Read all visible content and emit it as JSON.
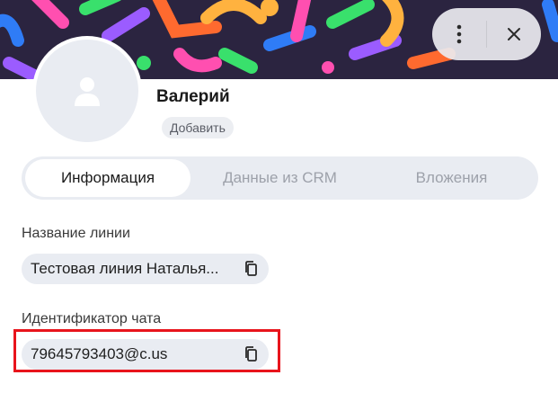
{
  "header": {
    "menu_icon": "more-vertical-icon",
    "close_icon": "close-icon",
    "banner_colors": [
      "#2b2440",
      "#2f7cf6",
      "#39e06c",
      "#ff4fb0",
      "#ffb23f",
      "#9b5cff",
      "#ff6a2f"
    ]
  },
  "contact": {
    "avatar_icon": "user-icon",
    "name": "Валерий",
    "add_label": "Добавить"
  },
  "tabs": [
    {
      "label": "Информация",
      "active": true
    },
    {
      "label": "Данные из CRM",
      "active": false
    },
    {
      "label": "Вложения",
      "active": false
    }
  ],
  "fields": [
    {
      "label": "Название линии",
      "value": "Тестовая линия Наталья...",
      "copy_icon": "copy-icon"
    },
    {
      "label": "Идентификатор чата",
      "value": "79645793403@c.us",
      "copy_icon": "copy-icon"
    }
  ],
  "colors": {
    "accent_highlight": "#e8141c",
    "pill_bg": "#e9ecf2"
  }
}
